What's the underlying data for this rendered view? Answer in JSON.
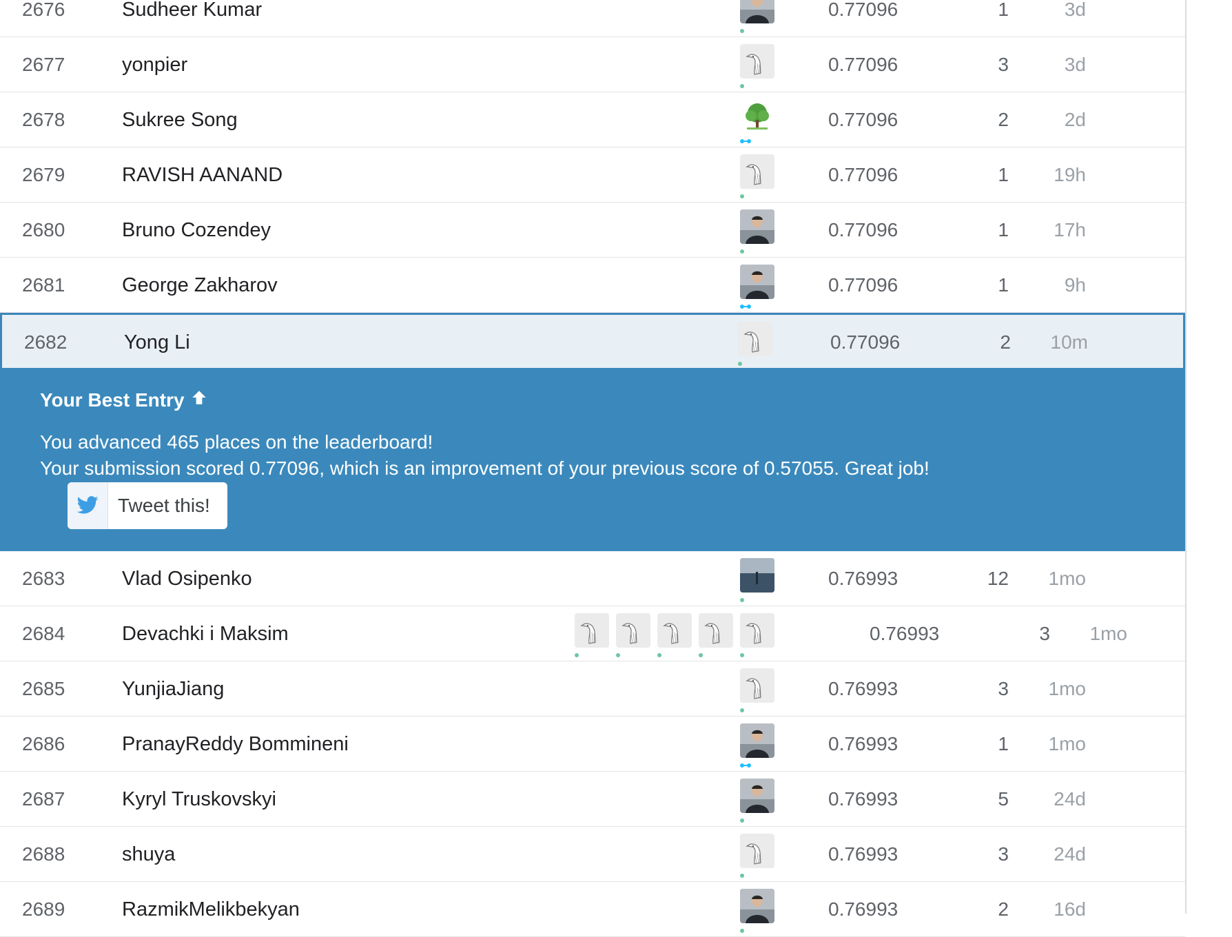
{
  "colors": {
    "accent": "#3b89bc",
    "current_row_bg": "#e8eff5",
    "tier_novice": "#20beff",
    "tier_contributor": "#6ec6a0"
  },
  "leaderboard_top": [
    {
      "rank": "2676",
      "name": "Sudheer Kumar",
      "avatars": [
        {
          "icon": "person-photo-avatar",
          "tier": "contributor"
        }
      ],
      "score": "0.77096",
      "entries": "1",
      "last": "3d"
    },
    {
      "rank": "2677",
      "name": "yonpier",
      "avatars": [
        {
          "icon": "goose-default-avatar",
          "tier": "contributor"
        }
      ],
      "score": "0.77096",
      "entries": "3",
      "last": "3d"
    },
    {
      "rank": "2678",
      "name": "Sukree Song",
      "avatars": [
        {
          "icon": "tree-avatar",
          "tier": "novice"
        }
      ],
      "score": "0.77096",
      "entries": "2",
      "last": "2d"
    },
    {
      "rank": "2679",
      "name": "RAVISH AANAND",
      "avatars": [
        {
          "icon": "goose-default-avatar",
          "tier": "contributor"
        }
      ],
      "score": "0.77096",
      "entries": "1",
      "last": "19h"
    },
    {
      "rank": "2680",
      "name": "Bruno Cozendey",
      "avatars": [
        {
          "icon": "person-photo-avatar",
          "tier": "contributor"
        }
      ],
      "score": "0.77096",
      "entries": "1",
      "last": "17h"
    },
    {
      "rank": "2681",
      "name": "George Zakharov",
      "avatars": [
        {
          "icon": "person-photo-avatar",
          "tier": "novice"
        }
      ],
      "score": "0.77096",
      "entries": "1",
      "last": "9h"
    }
  ],
  "current_entry": {
    "rank": "2682",
    "name": "Yong Li",
    "avatars": [
      {
        "icon": "goose-default-avatar",
        "tier": "contributor"
      }
    ],
    "score": "0.77096",
    "entries": "2",
    "last": "10m"
  },
  "banner": {
    "title": "Your Best Entry",
    "title_icon": "arrow-up-icon",
    "line1": "You advanced 465 places on the leaderboard!",
    "line2": "Your submission scored 0.77096, which is an improvement of your previous score of 0.57055. Great job!",
    "tweet_label": "Tweet this!",
    "tweet_icon": "twitter-bird-icon"
  },
  "leaderboard_bottom": [
    {
      "rank": "2683",
      "name": "Vlad Osipenko",
      "avatars": [
        {
          "icon": "landscape-photo-avatar",
          "tier": "contributor"
        }
      ],
      "score": "0.76993",
      "entries": "12",
      "last": "1mo"
    },
    {
      "rank": "2684",
      "name": "Devachki i Maksim",
      "team": true,
      "avatars": [
        {
          "icon": "goose-default-avatar",
          "tier": "contributor"
        },
        {
          "icon": "goose-default-avatar",
          "tier": "contributor"
        },
        {
          "icon": "goose-default-avatar",
          "tier": "contributor"
        },
        {
          "icon": "goose-default-avatar",
          "tier": "contributor"
        },
        {
          "icon": "goose-default-avatar",
          "tier": "contributor"
        }
      ],
      "score": "0.76993",
      "entries": "3",
      "last": "1mo"
    },
    {
      "rank": "2685",
      "name": "YunjiaJiang",
      "avatars": [
        {
          "icon": "goose-default-avatar",
          "tier": "contributor"
        }
      ],
      "score": "0.76993",
      "entries": "3",
      "last": "1mo"
    },
    {
      "rank": "2686",
      "name": "PranayReddy Bommineni",
      "avatars": [
        {
          "icon": "person-photo-avatar",
          "tier": "novice"
        }
      ],
      "score": "0.76993",
      "entries": "1",
      "last": "1mo"
    },
    {
      "rank": "2687",
      "name": "Kyryl Truskovskyi",
      "avatars": [
        {
          "icon": "person-photo-avatar",
          "tier": "contributor"
        }
      ],
      "score": "0.76993",
      "entries": "5",
      "last": "24d"
    },
    {
      "rank": "2688",
      "name": "shuya",
      "avatars": [
        {
          "icon": "goose-default-avatar",
          "tier": "contributor"
        }
      ],
      "score": "0.76993",
      "entries": "3",
      "last": "24d"
    },
    {
      "rank": "2689",
      "name": "RazmikMelikbekyan",
      "avatars": [
        {
          "icon": "person-photo-avatar",
          "tier": "contributor"
        }
      ],
      "score": "0.76993",
      "entries": "2",
      "last": "16d"
    }
  ]
}
